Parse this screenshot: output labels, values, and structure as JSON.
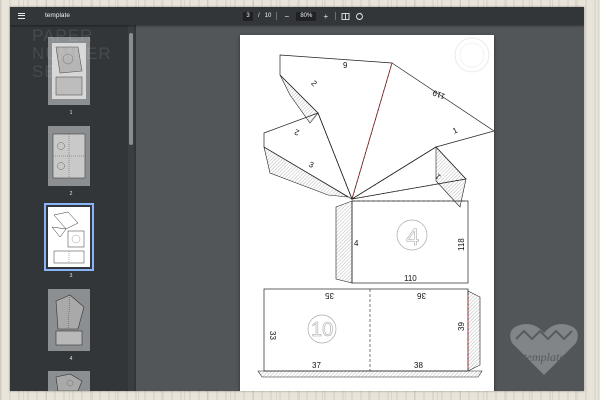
{
  "toolbar": {
    "title": "template",
    "current_page": "3",
    "page_separator": "/",
    "total_pages": "10",
    "zoom": "80%",
    "zoom_out": "−",
    "zoom_in": "+"
  },
  "sidebar": {
    "thumbnails": [
      {
        "label": "1"
      },
      {
        "label": "2"
      },
      {
        "label": "3",
        "selected": true
      },
      {
        "label": "4"
      }
    ]
  },
  "template_labels": {
    "n9": "9",
    "n119": "119",
    "n1a": "1",
    "n2a": "2",
    "n2b": "2",
    "n3": "3",
    "n1b": "1",
    "n4": "4",
    "n118": "118",
    "n110": "110",
    "circle_four": "4",
    "n35": "35",
    "n36": "36",
    "n33": "33",
    "circle_ten": "10",
    "n39": "39",
    "n37": "37",
    "n38": "38"
  },
  "watermark": {
    "line1": "PAPER",
    "line2": "NUMBER",
    "line3": "SE"
  },
  "brand": {
    "text": "template"
  },
  "colors": {
    "toolbar_bg": "#323639",
    "viewer_bg": "#525659",
    "selected_outline": "#8ab4f8",
    "fold_line_red": "#e0303a"
  }
}
